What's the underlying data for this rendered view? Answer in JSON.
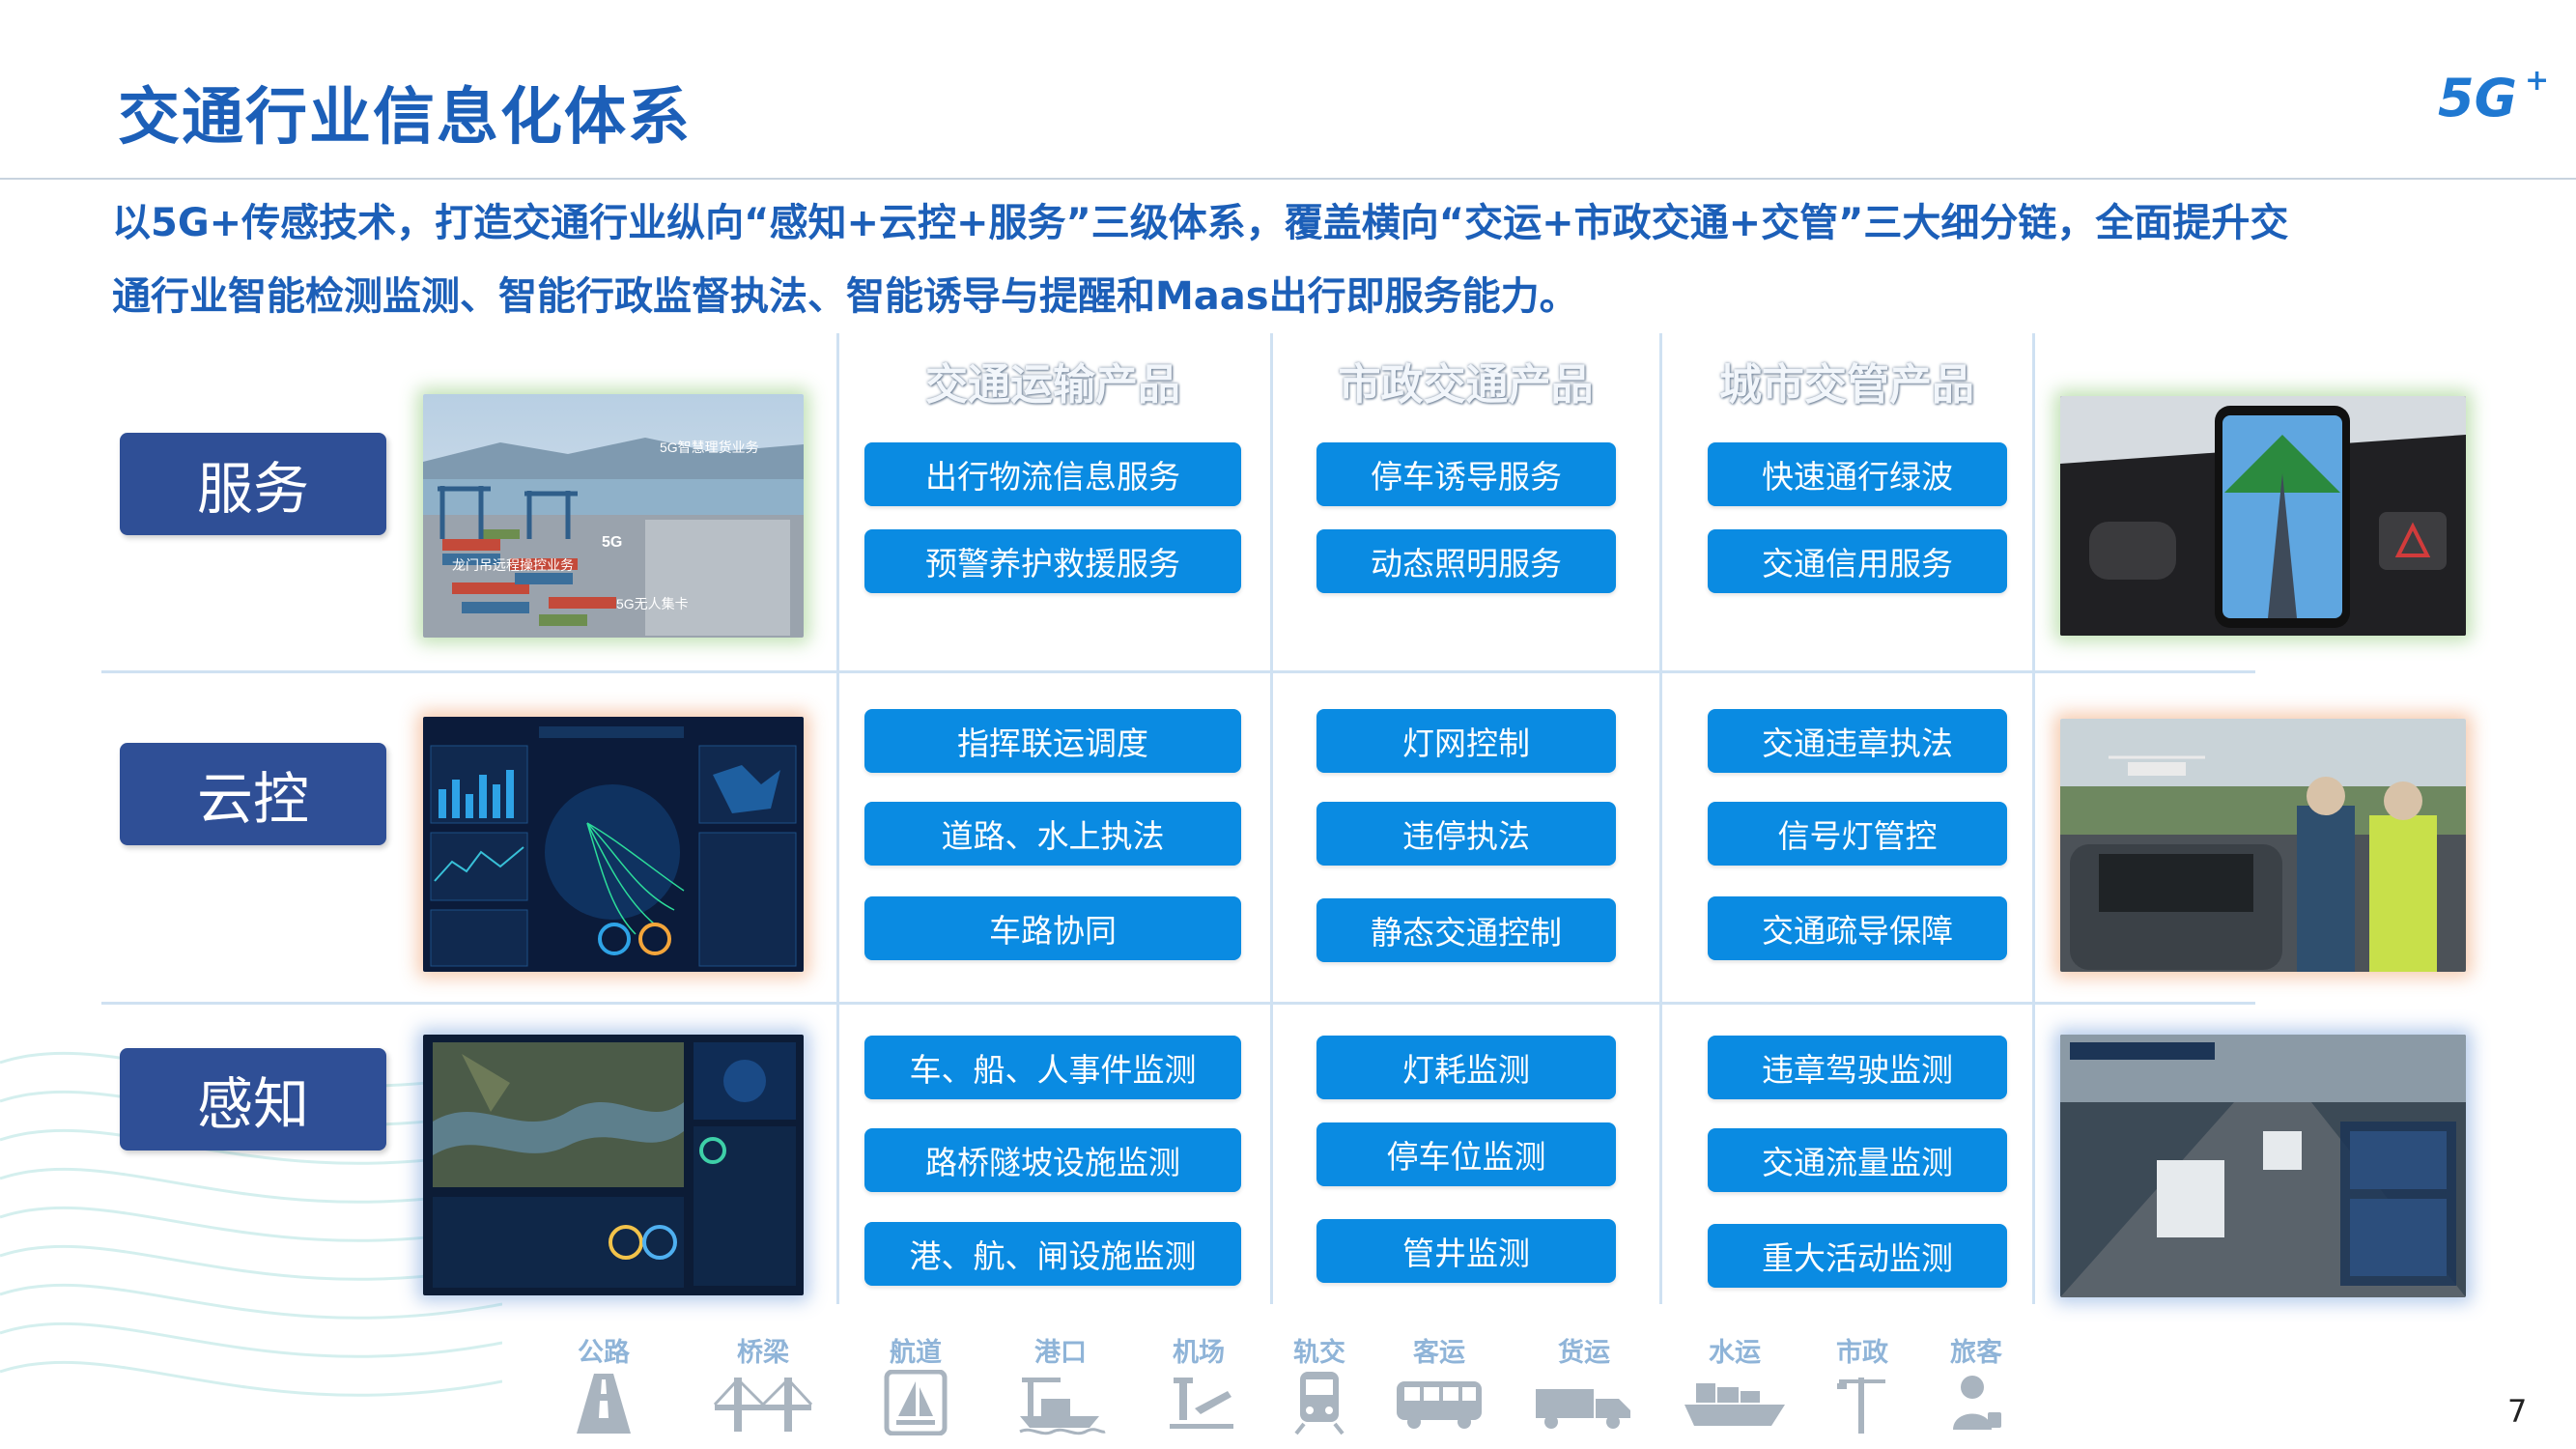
{
  "header": {
    "title": "交通行业信息化体系",
    "logo_text": "5G",
    "logo_plus": "+"
  },
  "intro": {
    "line1": "以5G+传感技术，打造交通行业纵向“感知+云控+服务”三级体系，覆盖横向“交运+市政交通+交管”三大细分链，全面提升交",
    "line2": "通行业智能检测监测、智能行政监督执法、智能诱导与提醒和Maas出行即服务能力。"
  },
  "columns": [
    "交通运输产品",
    "市政交通产品",
    "城市交管产品"
  ],
  "rows": [
    {
      "label": "服务",
      "left_photo": {
        "captions": [
          "5G智慧理货业务",
          "5G",
          "龙门吊远程操控业务",
          "5G无人集卡"
        ]
      },
      "transport": [
        "出行物流信息服务",
        "预警养护救援服务"
      ],
      "municipal": [
        "停车诱导服务",
        "动态照明服务"
      ],
      "police": [
        "快速通行绿波",
        "交通信用服务"
      ]
    },
    {
      "label": "云控",
      "transport": [
        "指挥联运调度",
        "道路、水上执法",
        "车路协同"
      ],
      "municipal": [
        "灯网控制",
        "违停执法",
        "静态交通控制"
      ],
      "police": [
        "交通违章执法",
        "信号灯管控",
        "交通疏导保障"
      ]
    },
    {
      "label": "感知",
      "transport": [
        "车、船、人事件监测",
        "路桥隧坡设施监测",
        "港、航、闸设施监测"
      ],
      "municipal": [
        "灯耗监测",
        "停车位监测",
        "管井监测"
      ],
      "police": [
        "违章驾驶监测",
        "交通流量监测",
        "重大活动监测"
      ]
    }
  ],
  "categories": [
    {
      "label": "公路",
      "icon": "road-icon"
    },
    {
      "label": "桥梁",
      "icon": "bridge-icon"
    },
    {
      "label": "航道",
      "icon": "sail-icon"
    },
    {
      "label": "港口",
      "icon": "port-icon"
    },
    {
      "label": "机场",
      "icon": "airport-icon"
    },
    {
      "label": "轨交",
      "icon": "train-icon"
    },
    {
      "label": "客运",
      "icon": "bus-icon"
    },
    {
      "label": "货运",
      "icon": "truck-icon"
    },
    {
      "label": "水运",
      "icon": "ship-icon"
    },
    {
      "label": "市政",
      "icon": "streetlight-icon"
    },
    {
      "label": "旅客",
      "icon": "passenger-icon"
    }
  ],
  "page_number": "7",
  "colors": {
    "title_blue": "#1c5fb8",
    "label_box": "#2f4f96",
    "pill_blue": "#0a8be2",
    "icon_grey": "#a9b4bf"
  }
}
